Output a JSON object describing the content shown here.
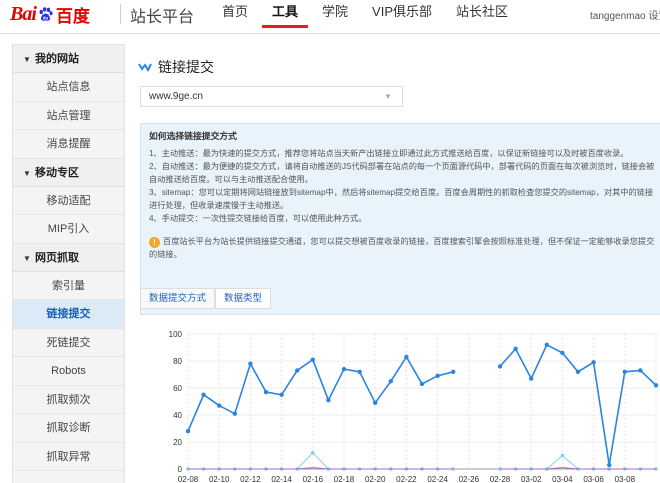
{
  "header": {
    "logo_bai": "Bai",
    "logo_du": "du",
    "logo_cn": "百度",
    "site_name": "站长平台",
    "nav": [
      "首页",
      "工具",
      "学院",
      "VIP俱乐部",
      "站长社区"
    ],
    "active_nav": 1,
    "user": "tanggenmao  设置"
  },
  "sidebar": {
    "groups": [
      {
        "label": "我的网站",
        "items": [
          "站点信息",
          "站点管理",
          "消息提醒"
        ]
      },
      {
        "label": "移动专区",
        "items": [
          "移动适配",
          "MIP引入"
        ]
      },
      {
        "label": "网页抓取",
        "items": [
          "索引量",
          "链接提交",
          "死链提交",
          "Robots",
          "抓取频次",
          "抓取诊断",
          "抓取异常"
        ]
      }
    ],
    "active_item": "链接提交"
  },
  "main": {
    "title": "链接提交",
    "site_select": "www.9ge.cn",
    "info": {
      "title": "如何选择链接提交方式",
      "lines": [
        "1、主动推送：最为快速的提交方式，推荐您将站点当天新产出链接立即通过此方式推送给百度，以保证新链接可以及时被百度收录。",
        "2、自动推送：最为便捷的提交方式，请将自动推送的JS代码部署在站点的每一个页面源代码中，部署代码的页面在每次被浏览时，链接会被",
        "自动推送给百度。可以与主动推送配合使用。",
        "3、sitemap：您可以定期将网站链接放到sitemap中，然后将sitemap提交给百度。百度会周期性的抓取检查您提交的sitemap，对其中的链接",
        "进行处理，但收录速度慢于主动推送。",
        "4、手动提交：一次性提交链接给百度，可以使用此种方式。"
      ],
      "notice": [
        "百度站长平台为站长提供链接提交通道，您可以提交想被百度收录的链接，百度搜索引擎会按照标准处理，但不保证一定能够收录您提交",
        "的链接。"
      ]
    },
    "tabs": [
      "数据提交方式",
      "数据类型"
    ]
  },
  "colors": {
    "accent": "#2466b8",
    "series_main": "#2a84e0",
    "series_light": "#7fd3e6",
    "series_purple": "#b060c8",
    "red": "#e02020"
  },
  "chart_data": {
    "type": "line",
    "y_ticks": [
      "100",
      "80",
      "60",
      "40",
      "20",
      "0"
    ],
    "ylim": [
      0,
      100
    ],
    "x_labels": [
      "02-08",
      "02-10",
      "02-12",
      "02-14",
      "02-16",
      "02-18",
      "02-20",
      "02-22",
      "02-24",
      "02-26",
      "02-28",
      "03-02",
      "03-04",
      "03-06",
      "03-08"
    ],
    "x": [
      "02-08",
      "02-09",
      "02-10",
      "02-11",
      "02-12",
      "02-13",
      "02-14",
      "02-15",
      "02-16",
      "02-17",
      "02-18",
      "02-19",
      "02-20",
      "02-21",
      "02-22",
      "02-23",
      "02-24",
      "02-25",
      "02-26",
      "02-27",
      "02-28",
      "03-01",
      "03-02",
      "03-03",
      "03-04",
      "03-05",
      "03-06",
      "03-07",
      "03-08",
      "03-09"
    ],
    "series": [
      {
        "values": [
          28,
          55,
          47,
          41,
          78,
          57,
          55,
          73,
          81,
          51,
          74,
          72,
          49,
          65,
          83,
          63,
          69,
          72,
          null,
          null,
          76,
          89,
          67,
          92,
          86,
          72,
          79,
          3,
          72,
          73,
          62
        ]
      },
      {
        "values": [
          0,
          0,
          0,
          0,
          0,
          0,
          0,
          0,
          12,
          0,
          0,
          0,
          0,
          0,
          0,
          0,
          0,
          0,
          null,
          null,
          0,
          0,
          0,
          0,
          10,
          0,
          0,
          0,
          0,
          0,
          0
        ]
      },
      {
        "values": [
          0,
          0,
          0,
          0,
          0,
          0,
          0,
          0,
          1,
          0,
          0,
          0,
          0,
          0,
          0,
          0,
          0,
          0,
          null,
          null,
          0,
          0,
          0,
          0,
          1,
          0,
          0,
          0,
          0,
          0,
          0
        ]
      }
    ]
  }
}
